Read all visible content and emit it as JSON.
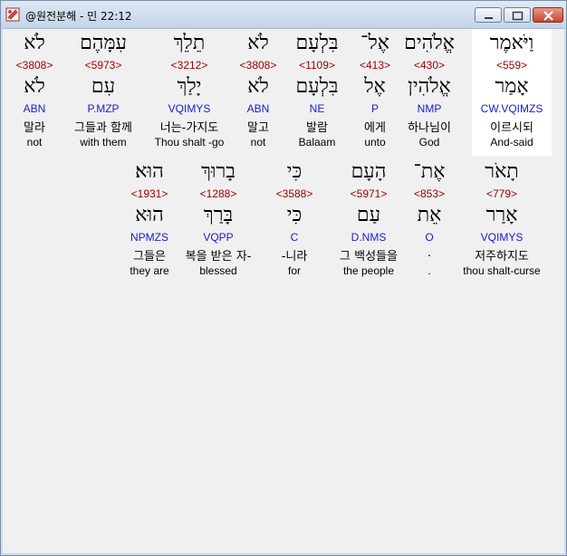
{
  "window": {
    "title": "@원전분해 - 민 22:12"
  },
  "icons": {
    "app": "app-logo-icon",
    "minimize": "minimize-icon",
    "maximize": "maximize-icon",
    "close": "close-icon"
  },
  "rows": [
    {
      "words": [
        {
          "heb": "וַיֹּאמֶר",
          "strong": "<559>",
          "lemma": "אָמַר",
          "morph": "CW.VQIMZS",
          "kor": "이르시되",
          "eng": "And-said",
          "highlight": true
        },
        {
          "heb": "אֱלֹהִים",
          "strong": "<430>",
          "lemma": "אֱלֹהִין",
          "morph": "NMP",
          "kor": "하나님이",
          "eng": "God"
        },
        {
          "heb": "אֶל־",
          "strong": "<413>",
          "lemma": "אֶל",
          "morph": "P",
          "kor": "에게",
          "eng": "unto"
        },
        {
          "heb": "בִּלְעָם",
          "strong": "<1109>",
          "lemma": "בִּלְעָם",
          "morph": "NE",
          "kor": "발람",
          "eng": "Balaam"
        },
        {
          "heb": "לֹא",
          "strong": "<3808>",
          "lemma": "לֹא",
          "morph": "ABN",
          "kor": "말고",
          "eng": "not"
        },
        {
          "heb": "תֵלֵךְ",
          "strong": "<3212>",
          "lemma": "יָלַךְ",
          "morph": "VQIMYS",
          "kor": "너는-가지도",
          "eng": "Thou shalt -go"
        },
        {
          "heb": "עִמָּהֶם",
          "strong": "<5973>",
          "lemma": "עִם",
          "morph": "P.MZP",
          "kor": "그들과 함께",
          "eng": "with them"
        },
        {
          "heb": "לֹא",
          "strong": "<3808>",
          "lemma": "לֹא",
          "morph": "ABN",
          "kor": "말라",
          "eng": "not"
        }
      ]
    },
    {
      "words": [
        {
          "heb": "תָאֹר",
          "strong": "<779>",
          "lemma": "אָרַר",
          "morph": "VQIMYS",
          "kor": "저주하지도",
          "eng": "thou shalt-curse"
        },
        {
          "heb": "אֶת־",
          "strong": "<853>",
          "lemma": "אֵת",
          "morph": "O",
          "kor": ".",
          "eng": "."
        },
        {
          "heb": "הָעָם",
          "strong": "<5971>",
          "lemma": "עַם",
          "morph": "D.NMS",
          "kor": "그 백성들을",
          "eng": "the people"
        },
        {
          "heb": "כִּי",
          "strong": "<3588>",
          "lemma": "כִּי",
          "morph": "C",
          "kor": "-니라",
          "eng": "for"
        },
        {
          "heb": "בָרוּךְ",
          "strong": "<1288>",
          "lemma": "בָּרַךְ",
          "morph": "VQPP",
          "kor": "복을 받은 자-",
          "eng": "blessed"
        },
        {
          "heb": "הוּא׃",
          "strong": "<1931>",
          "lemma": "הוּא",
          "morph": "NPMZS",
          "kor": "그들은",
          "eng": "they are"
        }
      ]
    }
  ]
}
